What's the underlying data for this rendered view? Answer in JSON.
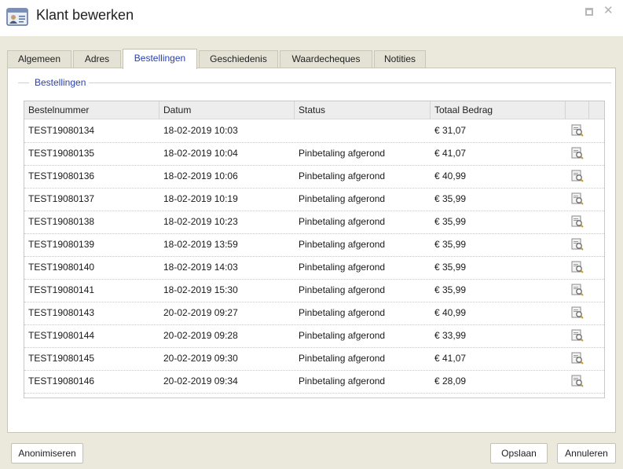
{
  "window": {
    "title": "Klant bewerken"
  },
  "tabs": [
    {
      "label": "Algemeen",
      "active": false
    },
    {
      "label": "Adres",
      "active": false
    },
    {
      "label": "Bestellingen",
      "active": true
    },
    {
      "label": "Geschiedenis",
      "active": false
    },
    {
      "label": "Waardecheques",
      "active": false
    },
    {
      "label": "Notities",
      "active": false
    }
  ],
  "section": {
    "legend": "Bestellingen"
  },
  "table": {
    "columns": [
      "Bestelnummer",
      "Datum",
      "Status",
      "Totaal Bedrag"
    ],
    "rows": [
      {
        "order": "TEST19080134",
        "date": "18-02-2019 10:03",
        "status": "",
        "amount": "€ 31,07"
      },
      {
        "order": "TEST19080135",
        "date": "18-02-2019 10:04",
        "status": "Pinbetaling afgerond",
        "amount": "€ 41,07"
      },
      {
        "order": "TEST19080136",
        "date": "18-02-2019 10:06",
        "status": "Pinbetaling afgerond",
        "amount": "€ 40,99"
      },
      {
        "order": "TEST19080137",
        "date": "18-02-2019 10:19",
        "status": "Pinbetaling afgerond",
        "amount": "€ 35,99"
      },
      {
        "order": "TEST19080138",
        "date": "18-02-2019 10:23",
        "status": "Pinbetaling afgerond",
        "amount": "€ 35,99"
      },
      {
        "order": "TEST19080139",
        "date": "18-02-2019 13:59",
        "status": "Pinbetaling afgerond",
        "amount": "€ 35,99"
      },
      {
        "order": "TEST19080140",
        "date": "18-02-2019 14:03",
        "status": "Pinbetaling afgerond",
        "amount": "€ 35,99"
      },
      {
        "order": "TEST19080141",
        "date": "18-02-2019 15:30",
        "status": "Pinbetaling afgerond",
        "amount": "€ 35,99"
      },
      {
        "order": "TEST19080143",
        "date": "20-02-2019 09:27",
        "status": "Pinbetaling afgerond",
        "amount": "€ 40,99"
      },
      {
        "order": "TEST19080144",
        "date": "20-02-2019 09:28",
        "status": "Pinbetaling afgerond",
        "amount": "€ 33,99"
      },
      {
        "order": "TEST19080145",
        "date": "20-02-2019 09:30",
        "status": "Pinbetaling afgerond",
        "amount": "€ 41,07"
      },
      {
        "order": "TEST19080146",
        "date": "20-02-2019 09:34",
        "status": "Pinbetaling afgerond",
        "amount": "€ 28,09"
      }
    ]
  },
  "buttons": {
    "anonymize": "Anonimiseren",
    "save": "Opslaan",
    "cancel": "Annuleren"
  },
  "colors": {
    "accent": "#2a3fa8",
    "background": "#ebe8dc"
  },
  "icons": {
    "app": "customer-card-icon",
    "row_action": "view-details-icon",
    "maximize": "maximize-icon",
    "close": "close-icon"
  }
}
